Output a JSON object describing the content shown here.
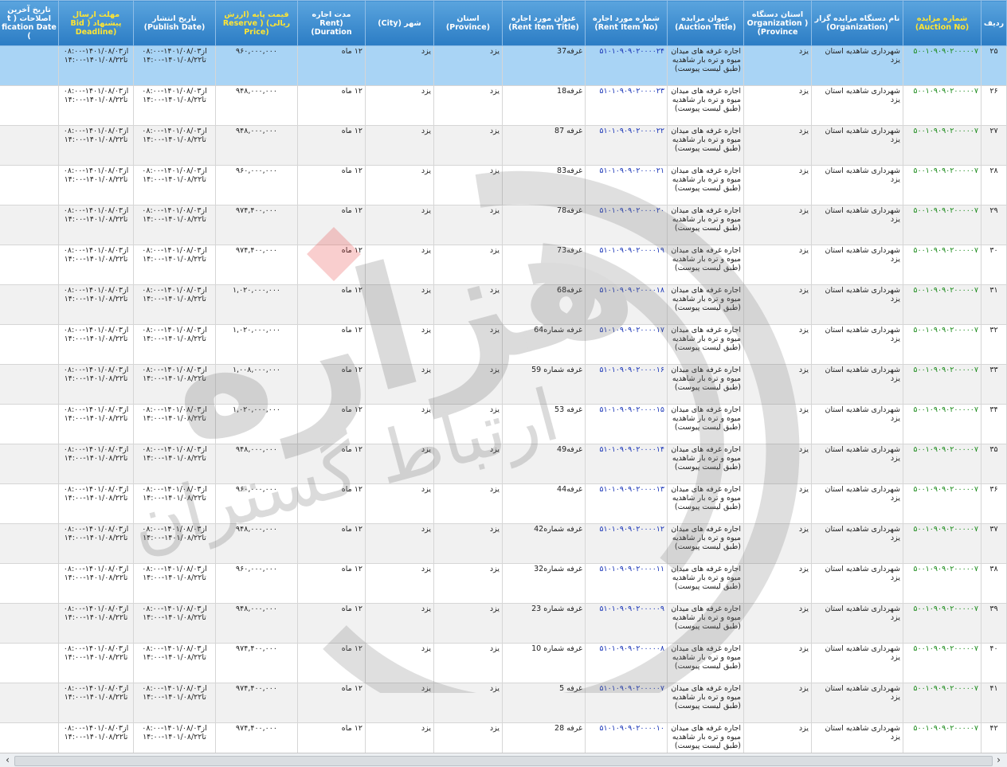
{
  "headers": [
    {
      "fa": "ردیف",
      "en": ""
    },
    {
      "fa": "شماره مزایده",
      "en": "(Auction No)",
      "hl": true
    },
    {
      "fa": "نام دستگاه مزایده گزار",
      "en": "(Organization)"
    },
    {
      "fa": "استان دستگاه",
      "en": "Organization ) (Province"
    },
    {
      "fa": "عنوان مزایده",
      "en": "(Auction Title)"
    },
    {
      "fa": "شماره مورد اجاره",
      "en": "(Rent Item No)"
    },
    {
      "fa": "عنوان مورد اجاره",
      "en": "(Rent Item Title)"
    },
    {
      "fa": "استان",
      "en": "(Province)"
    },
    {
      "fa": "شهر (City)",
      "en": ""
    },
    {
      "fa": "مدت اجاره",
      "en": "(Rent Duration)"
    },
    {
      "fa": "قیمت پایه (ارزش ریالی) ( Reserve",
      "en": "(Price",
      "hl": true
    },
    {
      "fa": "تاریخ انتشار",
      "en": "(Publish Date)"
    },
    {
      "fa": "مهلت ارسال پیشنهاد ( Bid",
      "en": "(Deadline",
      "hl": true
    },
    {
      "fa": "تاریخ آخرین اصلاحات ( t",
      "en": "fication Date )"
    }
  ],
  "common": {
    "org": "شهرداری شاهدیه استان یزد",
    "org_province": "یزد",
    "auction_title": "اجاره غرفه های میدان میوه و تره بار شاهدیه (طبق لیست پیوست)",
    "province": "یزد",
    "city": "یزد",
    "duration": "۱۲ ماه",
    "publish": "از۱۴۰۱/۰۸/۰۳-۰۸:۰۰ تا۱۴۰۱/۰۸/۲۲-۱۴:۰۰",
    "deadline": "از۱۴۰۱/۰۸/۰۳-۰۸:۰۰ تا۱۴۰۱/۰۸/۲۲-۱۴:۰۰"
  },
  "rows": [
    {
      "idx": "۲۵",
      "auction_no": "۵۰۰۱۰۹۰۹۰۲۰۰۰۰۰۷",
      "rent_no": "۵۱۰۱۰۹۰۹۰۲۰۰۰۰۲۴",
      "rent_title": "غرفه37",
      "price": "۹۶۰,۰۰۰,۰۰۰",
      "selected": true
    },
    {
      "idx": "۲۶",
      "auction_no": "۵۰۰۱۰۹۰۹۰۲۰۰۰۰۰۷",
      "rent_no": "۵۱۰۱۰۹۰۹۰۲۰۰۰۰۲۳",
      "rent_title": "غرفه18",
      "price": "۹۴۸,۰۰۰,۰۰۰"
    },
    {
      "idx": "۲۷",
      "auction_no": "۵۰۰۱۰۹۰۹۰۲۰۰۰۰۰۷",
      "rent_no": "۵۱۰۱۰۹۰۹۰۲۰۰۰۰۲۲",
      "rent_title": "غرفه 87",
      "price": "۹۴۸,۰۰۰,۰۰۰"
    },
    {
      "idx": "۲۸",
      "auction_no": "۵۰۰۱۰۹۰۹۰۲۰۰۰۰۰۷",
      "rent_no": "۵۱۰۱۰۹۰۹۰۲۰۰۰۰۲۱",
      "rent_title": "غرفه83",
      "price": "۹۶۰,۰۰۰,۰۰۰"
    },
    {
      "idx": "۲۹",
      "auction_no": "۵۰۰۱۰۹۰۹۰۲۰۰۰۰۰۷",
      "rent_no": "۵۱۰۱۰۹۰۹۰۲۰۰۰۰۲۰",
      "rent_title": "غرفه78",
      "price": "۹۷۴,۴۰۰,۰۰۰"
    },
    {
      "idx": "۳۰",
      "auction_no": "۵۰۰۱۰۹۰۹۰۲۰۰۰۰۰۷",
      "rent_no": "۵۱۰۱۰۹۰۹۰۲۰۰۰۰۱۹",
      "rent_title": "غرفه73",
      "price": "۹۷۴,۴۰۰,۰۰۰"
    },
    {
      "idx": "۳۱",
      "auction_no": "۵۰۰۱۰۹۰۹۰۲۰۰۰۰۰۷",
      "rent_no": "۵۱۰۱۰۹۰۹۰۲۰۰۰۰۱۸",
      "rent_title": "غرفه68",
      "price": "۱,۰۲۰,۰۰۰,۰۰۰"
    },
    {
      "idx": "۳۲",
      "auction_no": "۵۰۰۱۰۹۰۹۰۲۰۰۰۰۰۷",
      "rent_no": "۵۱۰۱۰۹۰۹۰۲۰۰۰۰۱۷",
      "rent_title": "غرفه شماره64",
      "price": "۱,۰۲۰,۰۰۰,۰۰۰"
    },
    {
      "idx": "۳۳",
      "auction_no": "۵۰۰۱۰۹۰۹۰۲۰۰۰۰۰۷",
      "rent_no": "۵۱۰۱۰۹۰۹۰۲۰۰۰۰۱۶",
      "rent_title": "غرفه شماره 59",
      "price": "۱,۰۰۸,۰۰۰,۰۰۰"
    },
    {
      "idx": "۳۴",
      "auction_no": "۵۰۰۱۰۹۰۹۰۲۰۰۰۰۰۷",
      "rent_no": "۵۱۰۱۰۹۰۹۰۲۰۰۰۰۱۵",
      "rent_title": "غرفه 53",
      "price": "۱,۰۲۰,۰۰۰,۰۰۰"
    },
    {
      "idx": "۳۵",
      "auction_no": "۵۰۰۱۰۹۰۹۰۲۰۰۰۰۰۷",
      "rent_no": "۵۱۰۱۰۹۰۹۰۲۰۰۰۰۱۴",
      "rent_title": "غرفه49",
      "price": "۹۴۸,۰۰۰,۰۰۰"
    },
    {
      "idx": "۳۶",
      "auction_no": "۵۰۰۱۰۹۰۹۰۲۰۰۰۰۰۷",
      "rent_no": "۵۱۰۱۰۹۰۹۰۲۰۰۰۰۱۳",
      "rent_title": "غرفه44",
      "price": "۹۶۰,۰۰۰,۰۰۰"
    },
    {
      "idx": "۳۷",
      "auction_no": "۵۰۰۱۰۹۰۹۰۲۰۰۰۰۰۷",
      "rent_no": "۵۱۰۱۰۹۰۹۰۲۰۰۰۰۱۲",
      "rent_title": "غرفه شماره42",
      "price": "۹۴۸,۰۰۰,۰۰۰"
    },
    {
      "idx": "۳۸",
      "auction_no": "۵۰۰۱۰۹۰۹۰۲۰۰۰۰۰۷",
      "rent_no": "۵۱۰۱۰۹۰۹۰۲۰۰۰۰۱۱",
      "rent_title": "غرفه شماره32",
      "price": "۹۶۰,۰۰۰,۰۰۰"
    },
    {
      "idx": "۳۹",
      "auction_no": "۵۰۰۱۰۹۰۹۰۲۰۰۰۰۰۷",
      "rent_no": "۵۱۰۱۰۹۰۹۰۲۰۰۰۰۰۹",
      "rent_title": "غرفه شماره 23",
      "price": "۹۴۸,۰۰۰,۰۰۰"
    },
    {
      "idx": "۴۰",
      "auction_no": "۵۰۰۱۰۹۰۹۰۲۰۰۰۰۰۷",
      "rent_no": "۵۱۰۱۰۹۰۹۰۲۰۰۰۰۰۸",
      "rent_title": "غرفه شماره 10",
      "price": "۹۷۴,۴۰۰,۰۰۰"
    },
    {
      "idx": "۴۱",
      "auction_no": "۵۰۰۱۰۹۰۹۰۲۰۰۰۰۰۷",
      "rent_no": "۵۱۰۱۰۹۰۹۰۲۰۰۰۰۰۷",
      "rent_title": "غرفه 5",
      "price": "۹۷۴,۴۰۰,۰۰۰"
    },
    {
      "idx": "۴۲",
      "auction_no": "۵۰۰۱۰۹۰۹۰۲۰۰۰۰۰۷",
      "rent_no": "۵۱۰۱۰۹۰۹۰۲۰۰۰۰۱۰",
      "rent_title": "غرفه 28",
      "price": "۹۷۴,۴۰۰,۰۰۰"
    }
  ],
  "watermark": {
    "brand": "هزاره",
    "sub": "ارتباط گستران"
  },
  "scroll": {
    "left_icon": "chevron-left-icon",
    "right_icon": "chevron-right-icon",
    "left": "‹",
    "right": "›"
  },
  "colors": {
    "header_top": "#5aa4de",
    "header_bottom": "#2b7cc4",
    "header_highlight": "#ffe533",
    "selected_row": "#a9d4f5",
    "auction_no": "#1a8a1a",
    "rent_no": "#1a36b8"
  }
}
